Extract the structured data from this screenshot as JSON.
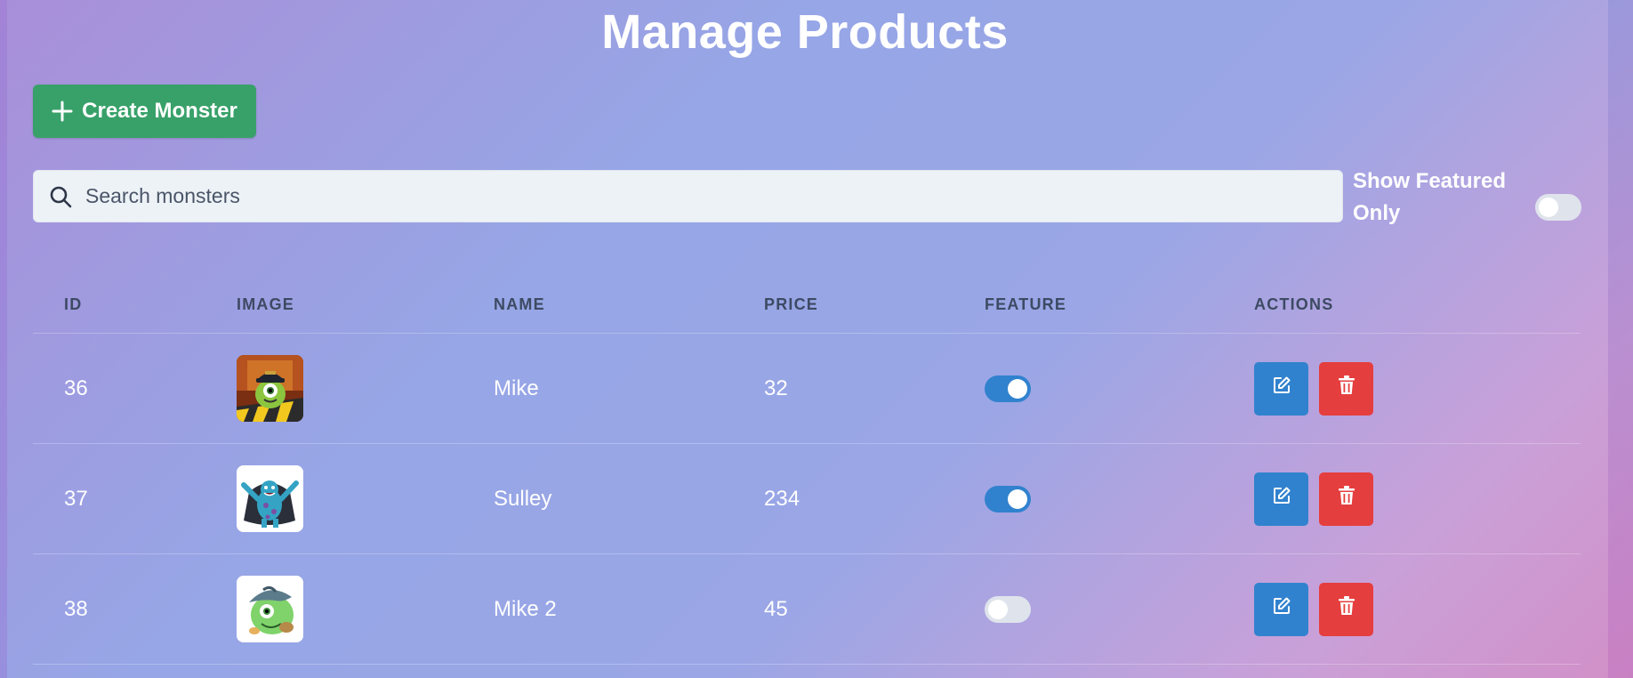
{
  "page": {
    "title": "Manage Products"
  },
  "toolbar": {
    "create_label": "Create Monster",
    "create_icon": "plus-icon"
  },
  "search": {
    "placeholder": "Search monsters",
    "value": "",
    "icon": "search-icon"
  },
  "filter": {
    "featured_label": "Show Featured Only",
    "featured_only": false
  },
  "table": {
    "headers": [
      "ID",
      "IMAGE",
      "NAME",
      "PRICE",
      "FEATURE",
      "ACTIONS"
    ],
    "rows": [
      {
        "id": "36",
        "name": "Mike",
        "price": "32",
        "featured": true,
        "image": "mike-monster-thumbnail"
      },
      {
        "id": "37",
        "name": "Sulley",
        "price": "234",
        "featured": true,
        "image": "sulley-monster-thumbnail"
      },
      {
        "id": "38",
        "name": "Mike 2",
        "price": "45",
        "featured": false,
        "image": "mike-2-monster-thumbnail"
      }
    ],
    "action_icons": {
      "edit": "edit-icon",
      "delete": "trash-icon"
    }
  },
  "colors": {
    "create_button": "#38a169",
    "edit_button": "#3182ce",
    "delete_button": "#e53e3e",
    "toggle_on": "#3182ce",
    "toggle_off": "#dfe4ec"
  }
}
